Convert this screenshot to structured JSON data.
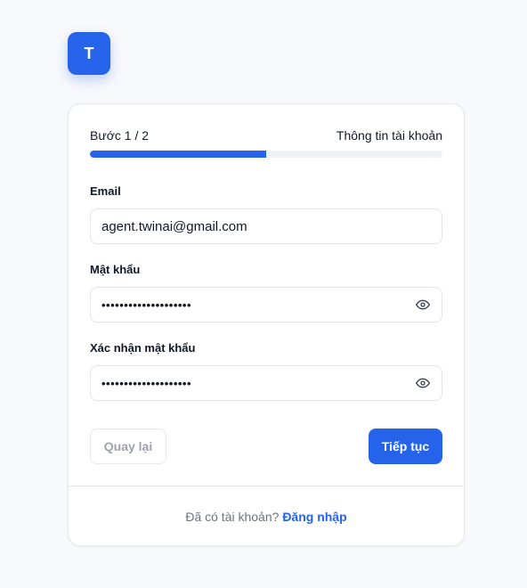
{
  "logo": {
    "letter": "T"
  },
  "progress": {
    "step_label": "Bước 1 / 2",
    "step_title": "Thông tin tài khoản",
    "fraction": 0.5
  },
  "fields": {
    "email": {
      "label": "Email",
      "value": "agent.twinai@gmail.com"
    },
    "password": {
      "label": "Mật khẩu",
      "value": "••••••••••••••••••••",
      "icon": "eye-icon"
    },
    "confirm": {
      "label": "Xác nhận mật khẩu",
      "value": "••••••••••••••••••••",
      "icon": "eye-icon"
    }
  },
  "buttons": {
    "back": "Quay lại",
    "next": "Tiếp tục"
  },
  "footer": {
    "prompt": "Đã có tài khoản?",
    "link": "Đăng nhập"
  },
  "colors": {
    "accent": "#2563eb",
    "background": "#f8f9fb",
    "track": "#eef1f5"
  }
}
